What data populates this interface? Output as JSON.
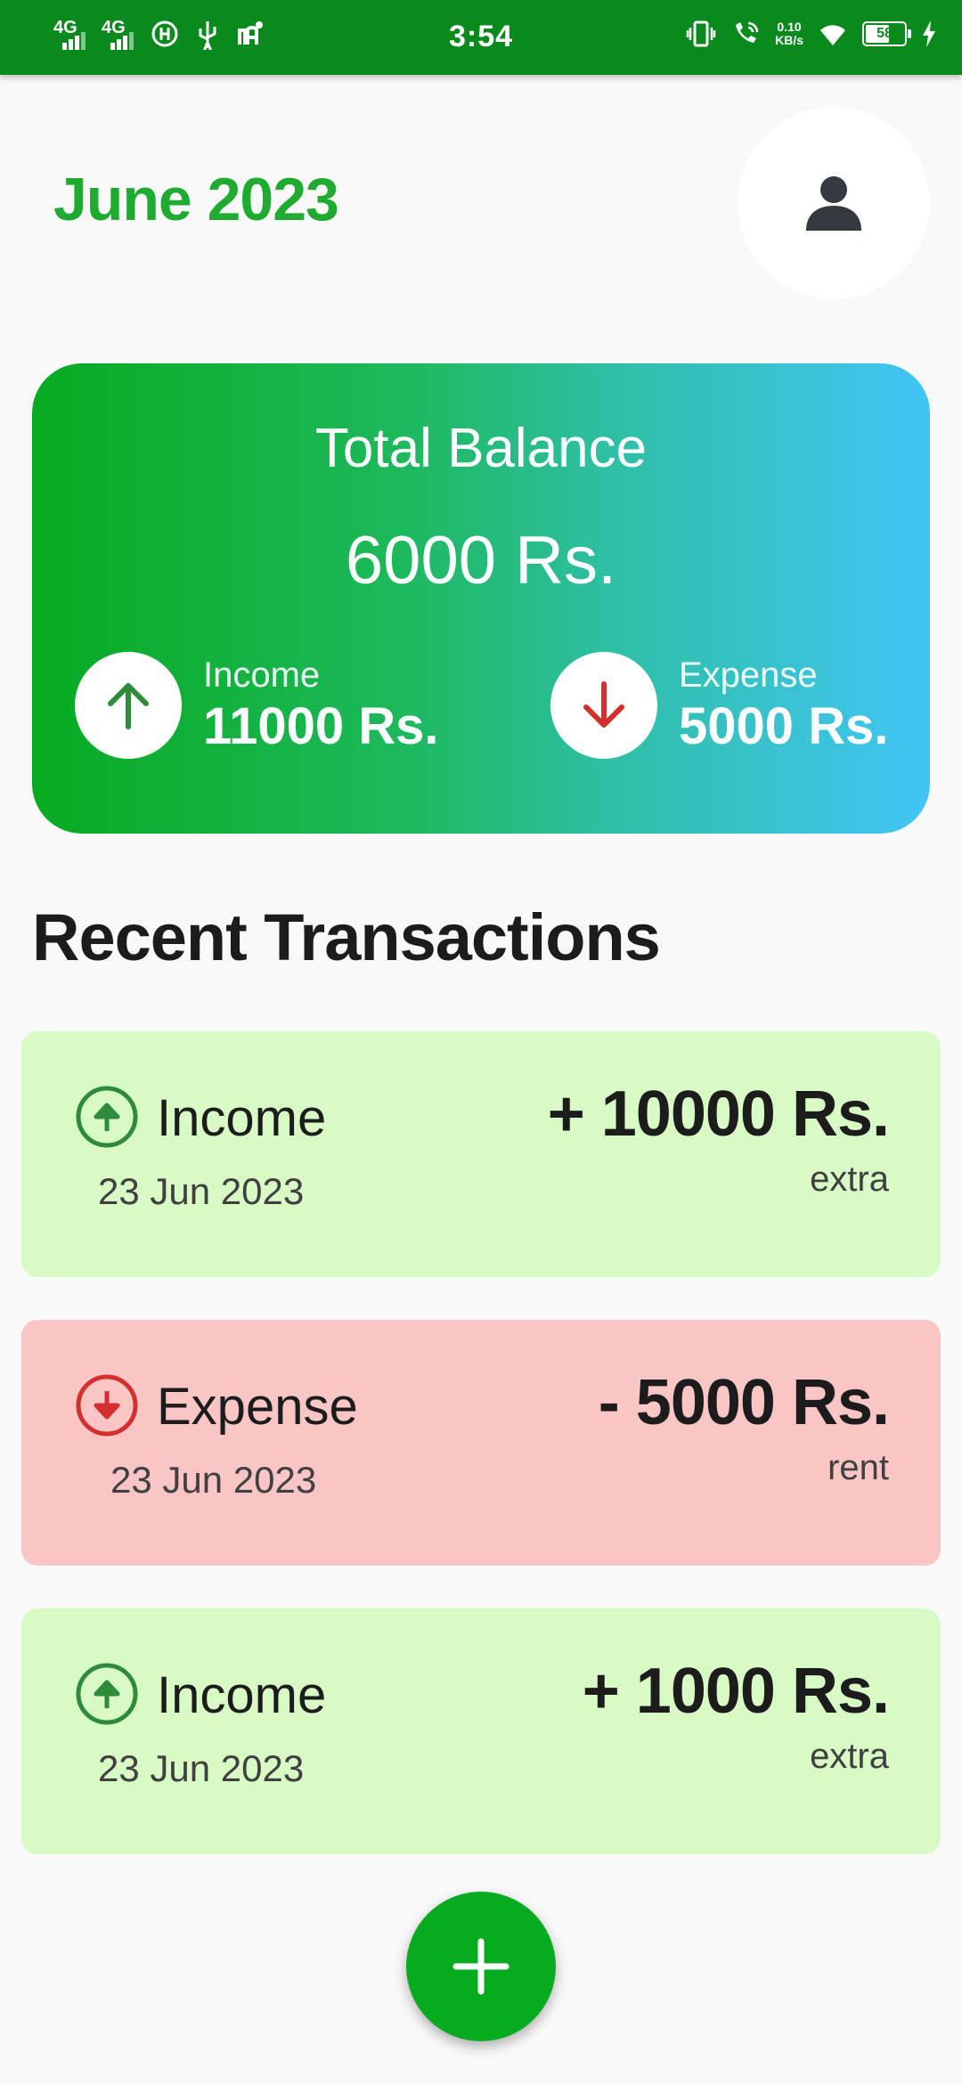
{
  "status_bar": {
    "time": "3:54",
    "network_1": "4G",
    "network_2": "4G",
    "speed_value": "0.10",
    "speed_unit": "KB/s",
    "battery": "58"
  },
  "header": {
    "month": "June 2023"
  },
  "balance_card": {
    "title": "Total Balance",
    "amount": "6000 Rs.",
    "income_label": "Income",
    "income_value": "11000 Rs.",
    "expense_label": "Expense",
    "expense_value": "5000 Rs."
  },
  "recent": {
    "title": "Recent Transactions",
    "transactions": [
      {
        "type": "Income",
        "date": "23 Jun 2023",
        "amount": "+ 10000 Rs.",
        "note": "extra",
        "kind": "income"
      },
      {
        "type": "Expense",
        "date": "23 Jun 2023",
        "amount": "- 5000 Rs.",
        "note": "rent",
        "kind": "expense"
      },
      {
        "type": "Income",
        "date": "23 Jun 2023",
        "amount": "+ 1000 Rs.",
        "note": "extra",
        "kind": "income"
      }
    ]
  },
  "colors": {
    "status_bar": "#0a8a1d",
    "accent_green": "#1faa30",
    "income_bg": "#d8fac5",
    "expense_bg": "#f9c5c5",
    "income_icon": "#2e8b3a",
    "expense_icon": "#d32f2f",
    "fab": "#07ab20"
  },
  "icons": {
    "profile": "person-icon",
    "income": "arrow-up-icon",
    "expense": "arrow-down-icon",
    "fab": "plus-icon"
  }
}
